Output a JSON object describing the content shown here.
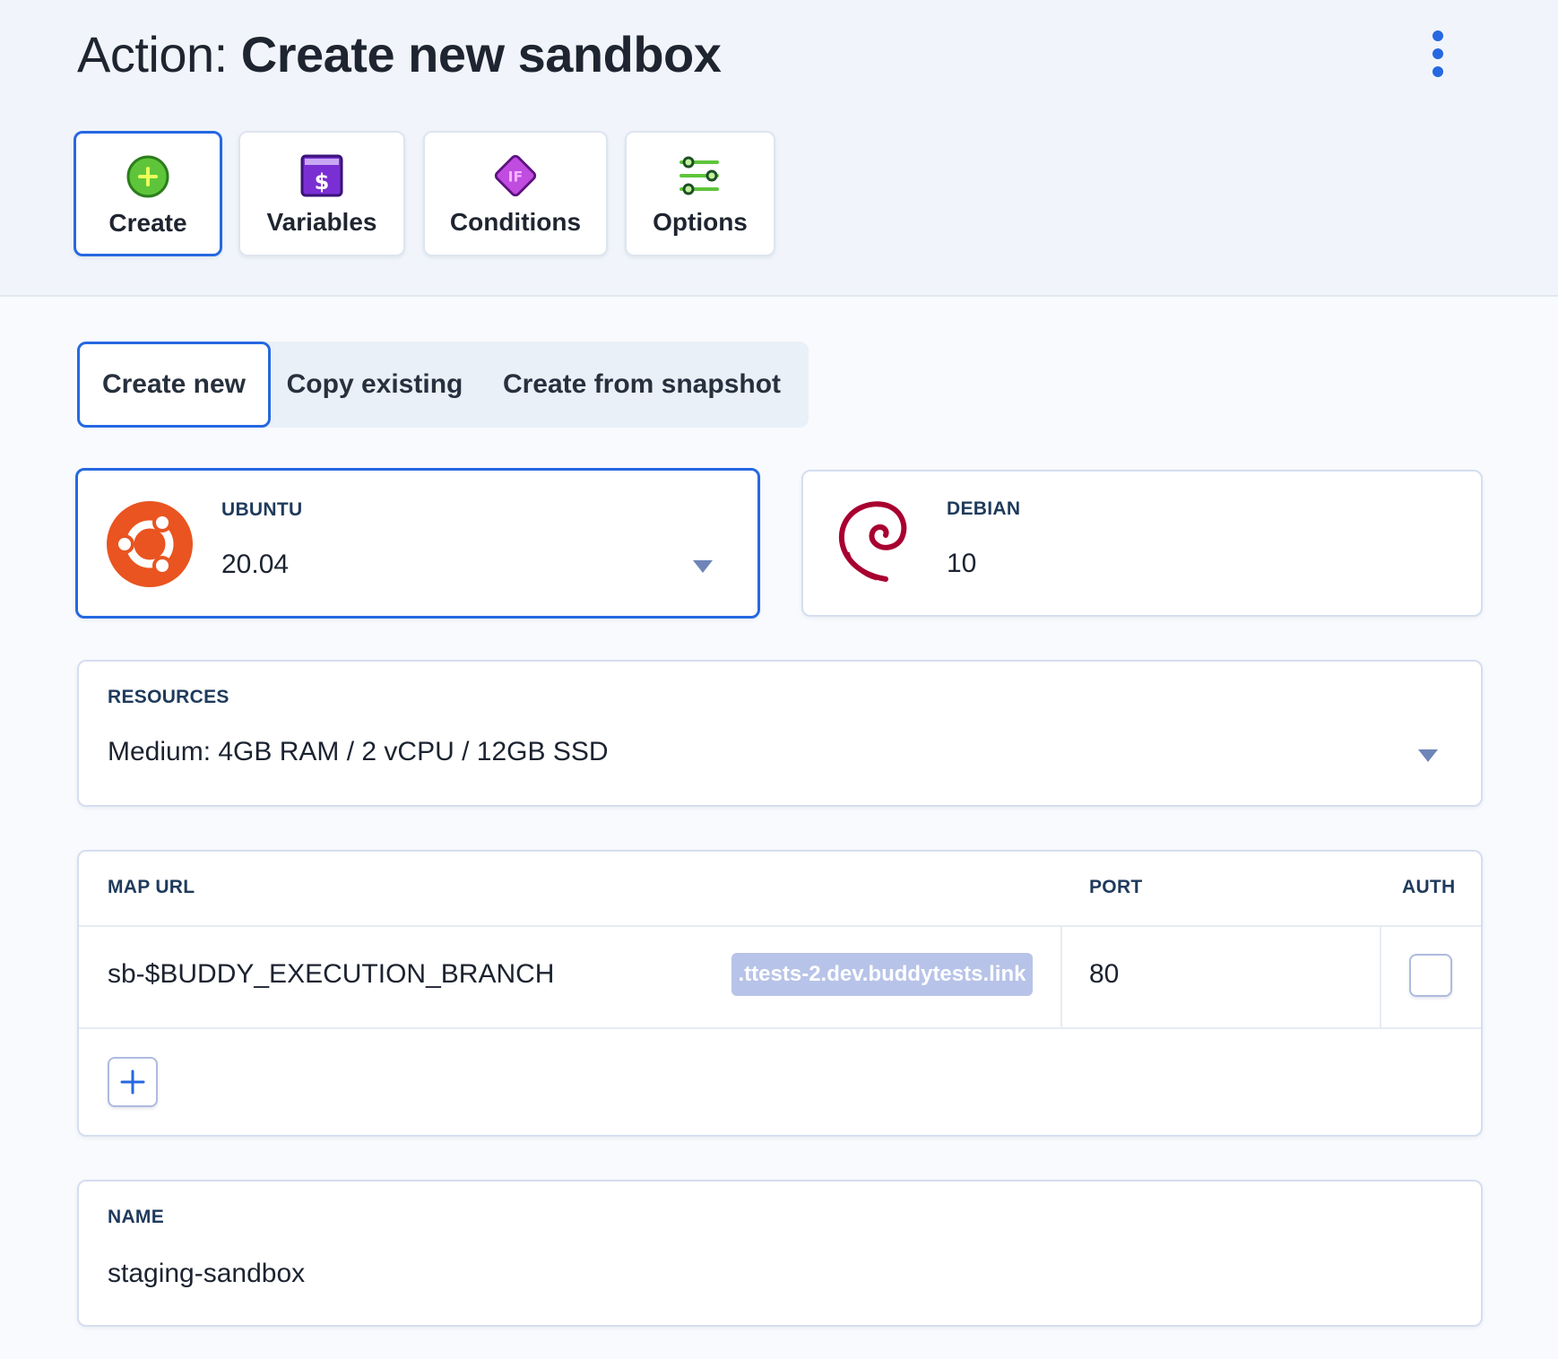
{
  "header": {
    "title_prefix": "Action: ",
    "title_strong": "Create new sandbox",
    "menu_icon": "kebab-menu-icon"
  },
  "tabs": [
    {
      "label": "Create",
      "icon": "plus-circle-icon",
      "active": true
    },
    {
      "label": "Variables",
      "icon": "dollar-icon",
      "active": false
    },
    {
      "label": "Conditions",
      "icon": "if-diamond-icon",
      "active": false
    },
    {
      "label": "Options",
      "icon": "sliders-icon",
      "active": false
    }
  ],
  "mode": {
    "options": [
      "Create new",
      "Copy existing",
      "Create from snapshot"
    ],
    "selected": "Create new"
  },
  "os": {
    "ubuntu": {
      "label": "UBUNTU",
      "value": "20.04",
      "icon": "ubuntu-logo-icon",
      "color": "#e95420"
    },
    "debian": {
      "label": "DEBIAN",
      "value": "10",
      "icon": "debian-logo-icon",
      "color": "#a80030"
    }
  },
  "resources": {
    "label": "RESOURCES",
    "value": "Medium: 4GB RAM / 2 vCPU / 12GB SSD"
  },
  "map": {
    "headers": {
      "url": "MAP URL",
      "port": "PORT",
      "auth": "AUTH"
    },
    "rows": [
      {
        "subdomain": "sb-$BUDDY_EXECUTION_BRANCH",
        "domain": ".ttests-2.dev.buddytests.link",
        "port": "80",
        "auth": false
      }
    ],
    "add_icon": "plus-icon"
  },
  "name": {
    "label": "NAME",
    "value": "staging-sandbox"
  },
  "colors": {
    "accent": "#2668e1",
    "background": "#f8fafd"
  }
}
